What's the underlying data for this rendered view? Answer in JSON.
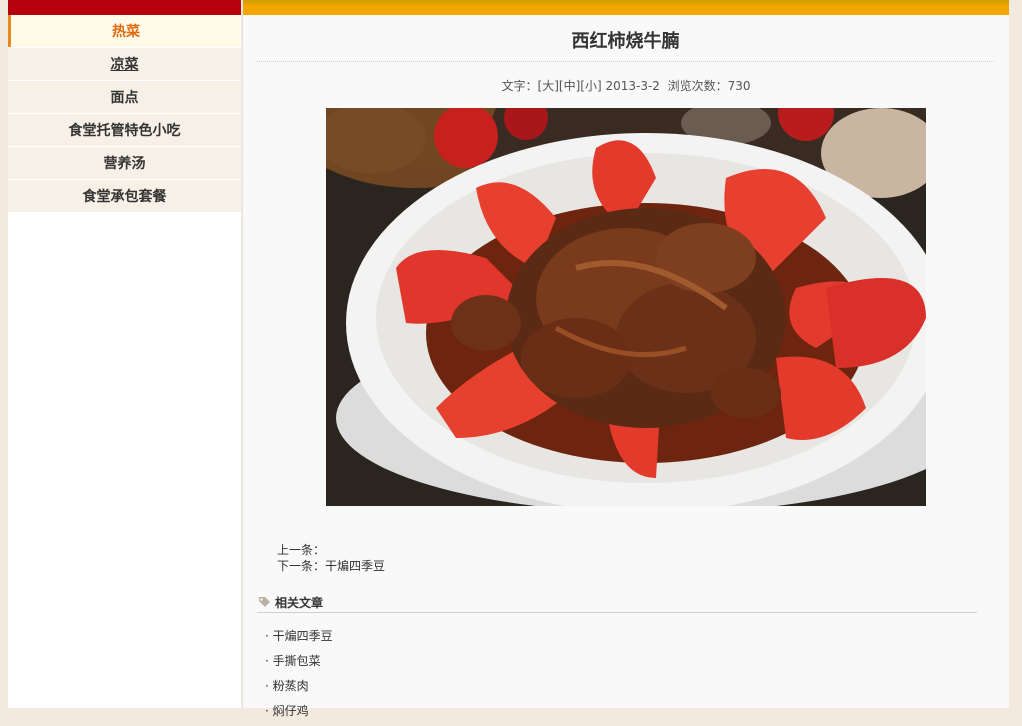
{
  "sidebar": {
    "items": [
      {
        "label": "热菜",
        "active": true
      },
      {
        "label": "凉菜"
      },
      {
        "label": "面点"
      },
      {
        "label": "食堂托管特色小吃"
      },
      {
        "label": "营养汤"
      },
      {
        "label": "食堂承包套餐"
      }
    ]
  },
  "article": {
    "title": "西红柿烧牛腩",
    "meta": {
      "text_label": "文字：",
      "size_large": "[大]",
      "size_medium": "[中]",
      "size_small": "[小]",
      "date": "2013-3-2",
      "views_label": "浏览次数：",
      "views": "730"
    },
    "prev_label": "上一条：",
    "prev_title": "",
    "next_label": "下一条：",
    "next_title": "干煸四季豆"
  },
  "related": {
    "title": "相关文章",
    "icon": "tag-icon",
    "items": [
      "干煸四季豆",
      "手撕包菜",
      "粉蒸肉",
      "焖仔鸡"
    ]
  },
  "colors": {
    "sidebar_topbar": "#b5000d",
    "main_topbar": "#f5a800",
    "active_menu_text": "#e06a10",
    "page_background": "#f4e9de"
  }
}
